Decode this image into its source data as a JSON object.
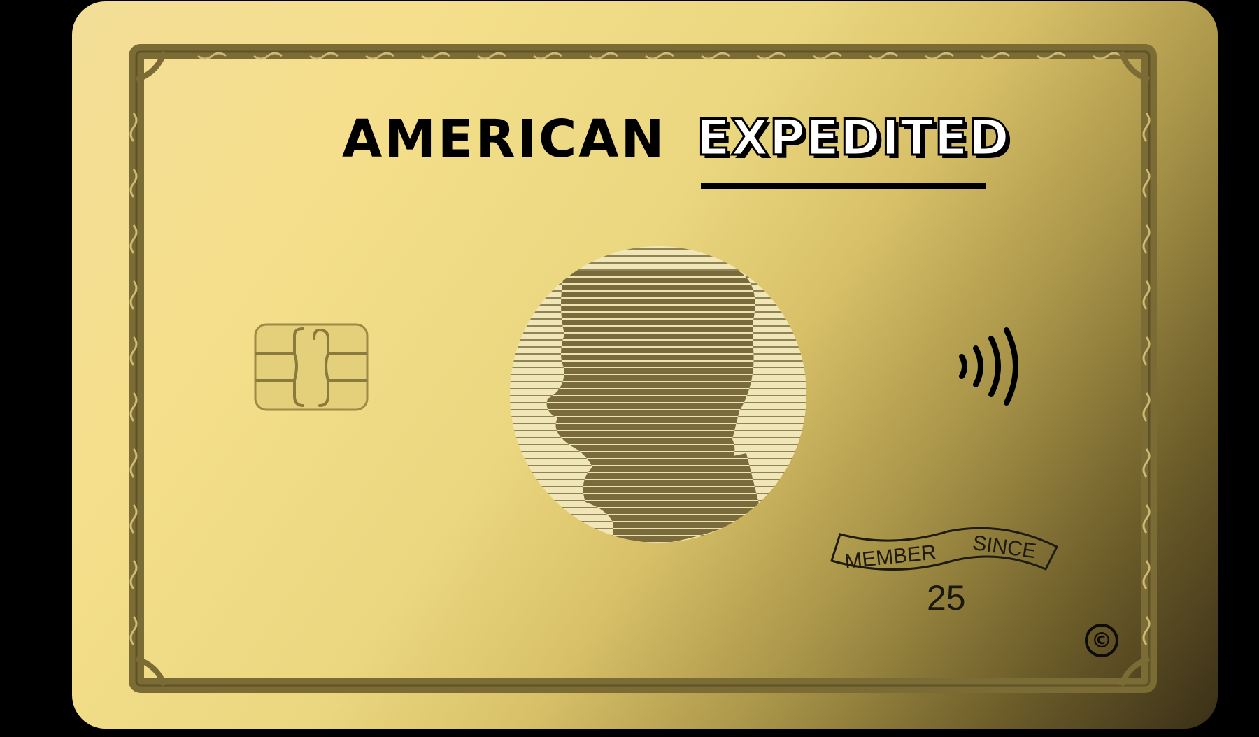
{
  "card": {
    "brand_left": "AMERICAN",
    "brand_right": "EXPEDITED",
    "member_label_1": "MEMBER",
    "member_label_2": "SINCE",
    "member_year": "25",
    "copyright_symbol": "©"
  },
  "icons": {
    "chip": "emv-chip-icon",
    "contactless": "contactless-icon",
    "portrait": "centurion-portrait",
    "copyright": "copyright-icon"
  },
  "colors": {
    "background": "#000000",
    "card_gold_light": "#f5df8c",
    "card_gold_dark": "#3a2f17",
    "border": "#7a6a36",
    "text_dark": "#000000"
  }
}
